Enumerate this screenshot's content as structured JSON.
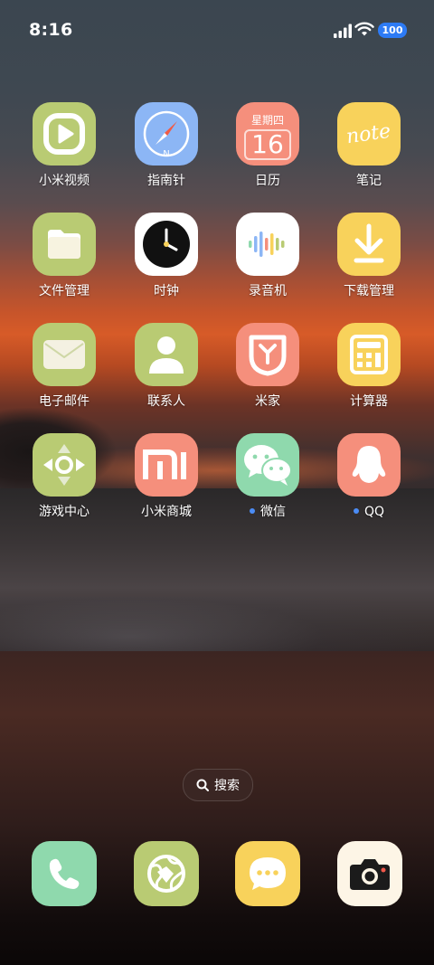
{
  "status_bar": {
    "time": "8:16",
    "battery": "100"
  },
  "apps": [
    {
      "label": "小米视频",
      "icon": "video-play-icon",
      "color": "#b9cb73"
    },
    {
      "label": "指南针",
      "icon": "compass-icon",
      "color": "#8cb6f5"
    },
    {
      "label": "日历",
      "icon": "calendar-icon",
      "color": "#f58f7c",
      "day_name": "星期四",
      "day": "16"
    },
    {
      "label": "笔记",
      "icon": "note-icon",
      "color": "#f8d25b",
      "icon_text": "note"
    },
    {
      "label": "文件管理",
      "icon": "folder-icon",
      "color": "#b9cb73"
    },
    {
      "label": "时钟",
      "icon": "clock-icon",
      "color": "#ffffff"
    },
    {
      "label": "录音机",
      "icon": "sound-wave-icon",
      "color": "#ffffff"
    },
    {
      "label": "下载管理",
      "icon": "download-icon",
      "color": "#f8d25b"
    },
    {
      "label": "电子邮件",
      "icon": "mail-icon",
      "color": "#b9cb73"
    },
    {
      "label": "联系人",
      "icon": "person-icon",
      "color": "#b9cb73"
    },
    {
      "label": "米家",
      "icon": "mijia-icon",
      "color": "#f58f7c"
    },
    {
      "label": "计算器",
      "icon": "calculator-icon",
      "color": "#f8d25b"
    },
    {
      "label": "游戏中心",
      "icon": "gamepad-icon",
      "color": "#b9cb73"
    },
    {
      "label": "小米商城",
      "icon": "mi-logo-icon",
      "color": "#f58f7c",
      "icon_text": "mi"
    },
    {
      "label": "微信",
      "icon": "wechat-icon",
      "color": "#8fd9ad",
      "badge_dot": true
    },
    {
      "label": "QQ",
      "icon": "qq-penguin-icon",
      "color": "#f58f7c",
      "badge_dot": true
    }
  ],
  "search": {
    "label": "搜索"
  },
  "dock": [
    {
      "name": "phone",
      "icon": "phone-icon",
      "color": "#8fd9ad"
    },
    {
      "name": "browser",
      "icon": "globe-icon",
      "color": "#b9cb73"
    },
    {
      "name": "messages",
      "icon": "message-bubble-icon",
      "color": "#f8d25b"
    },
    {
      "name": "camera",
      "icon": "camera-icon",
      "color": "#fdf5e6"
    }
  ]
}
